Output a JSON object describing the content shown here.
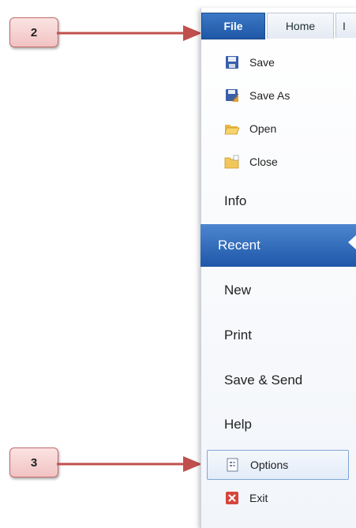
{
  "callouts": {
    "step2": "2",
    "step3": "3"
  },
  "tabs": {
    "file": "File",
    "home": "Home",
    "more": "I"
  },
  "quick_items": [
    {
      "label": "Save",
      "icon": "save-icon"
    },
    {
      "label": "Save As",
      "icon": "save-as-icon"
    },
    {
      "label": "Open",
      "icon": "open-folder-icon"
    },
    {
      "label": "Close",
      "icon": "close-folder-icon"
    }
  ],
  "nav": {
    "info": "Info",
    "recent": "Recent",
    "new": "New",
    "print": "Print",
    "save_send": "Save & Send",
    "help": "Help"
  },
  "bottom_items": {
    "options": "Options",
    "exit": "Exit"
  },
  "colors": {
    "file_tab": "#1f57a6",
    "selected": "#2e6ab8",
    "callout_fill": "#f4cccc",
    "arrow": "#c0504d"
  }
}
